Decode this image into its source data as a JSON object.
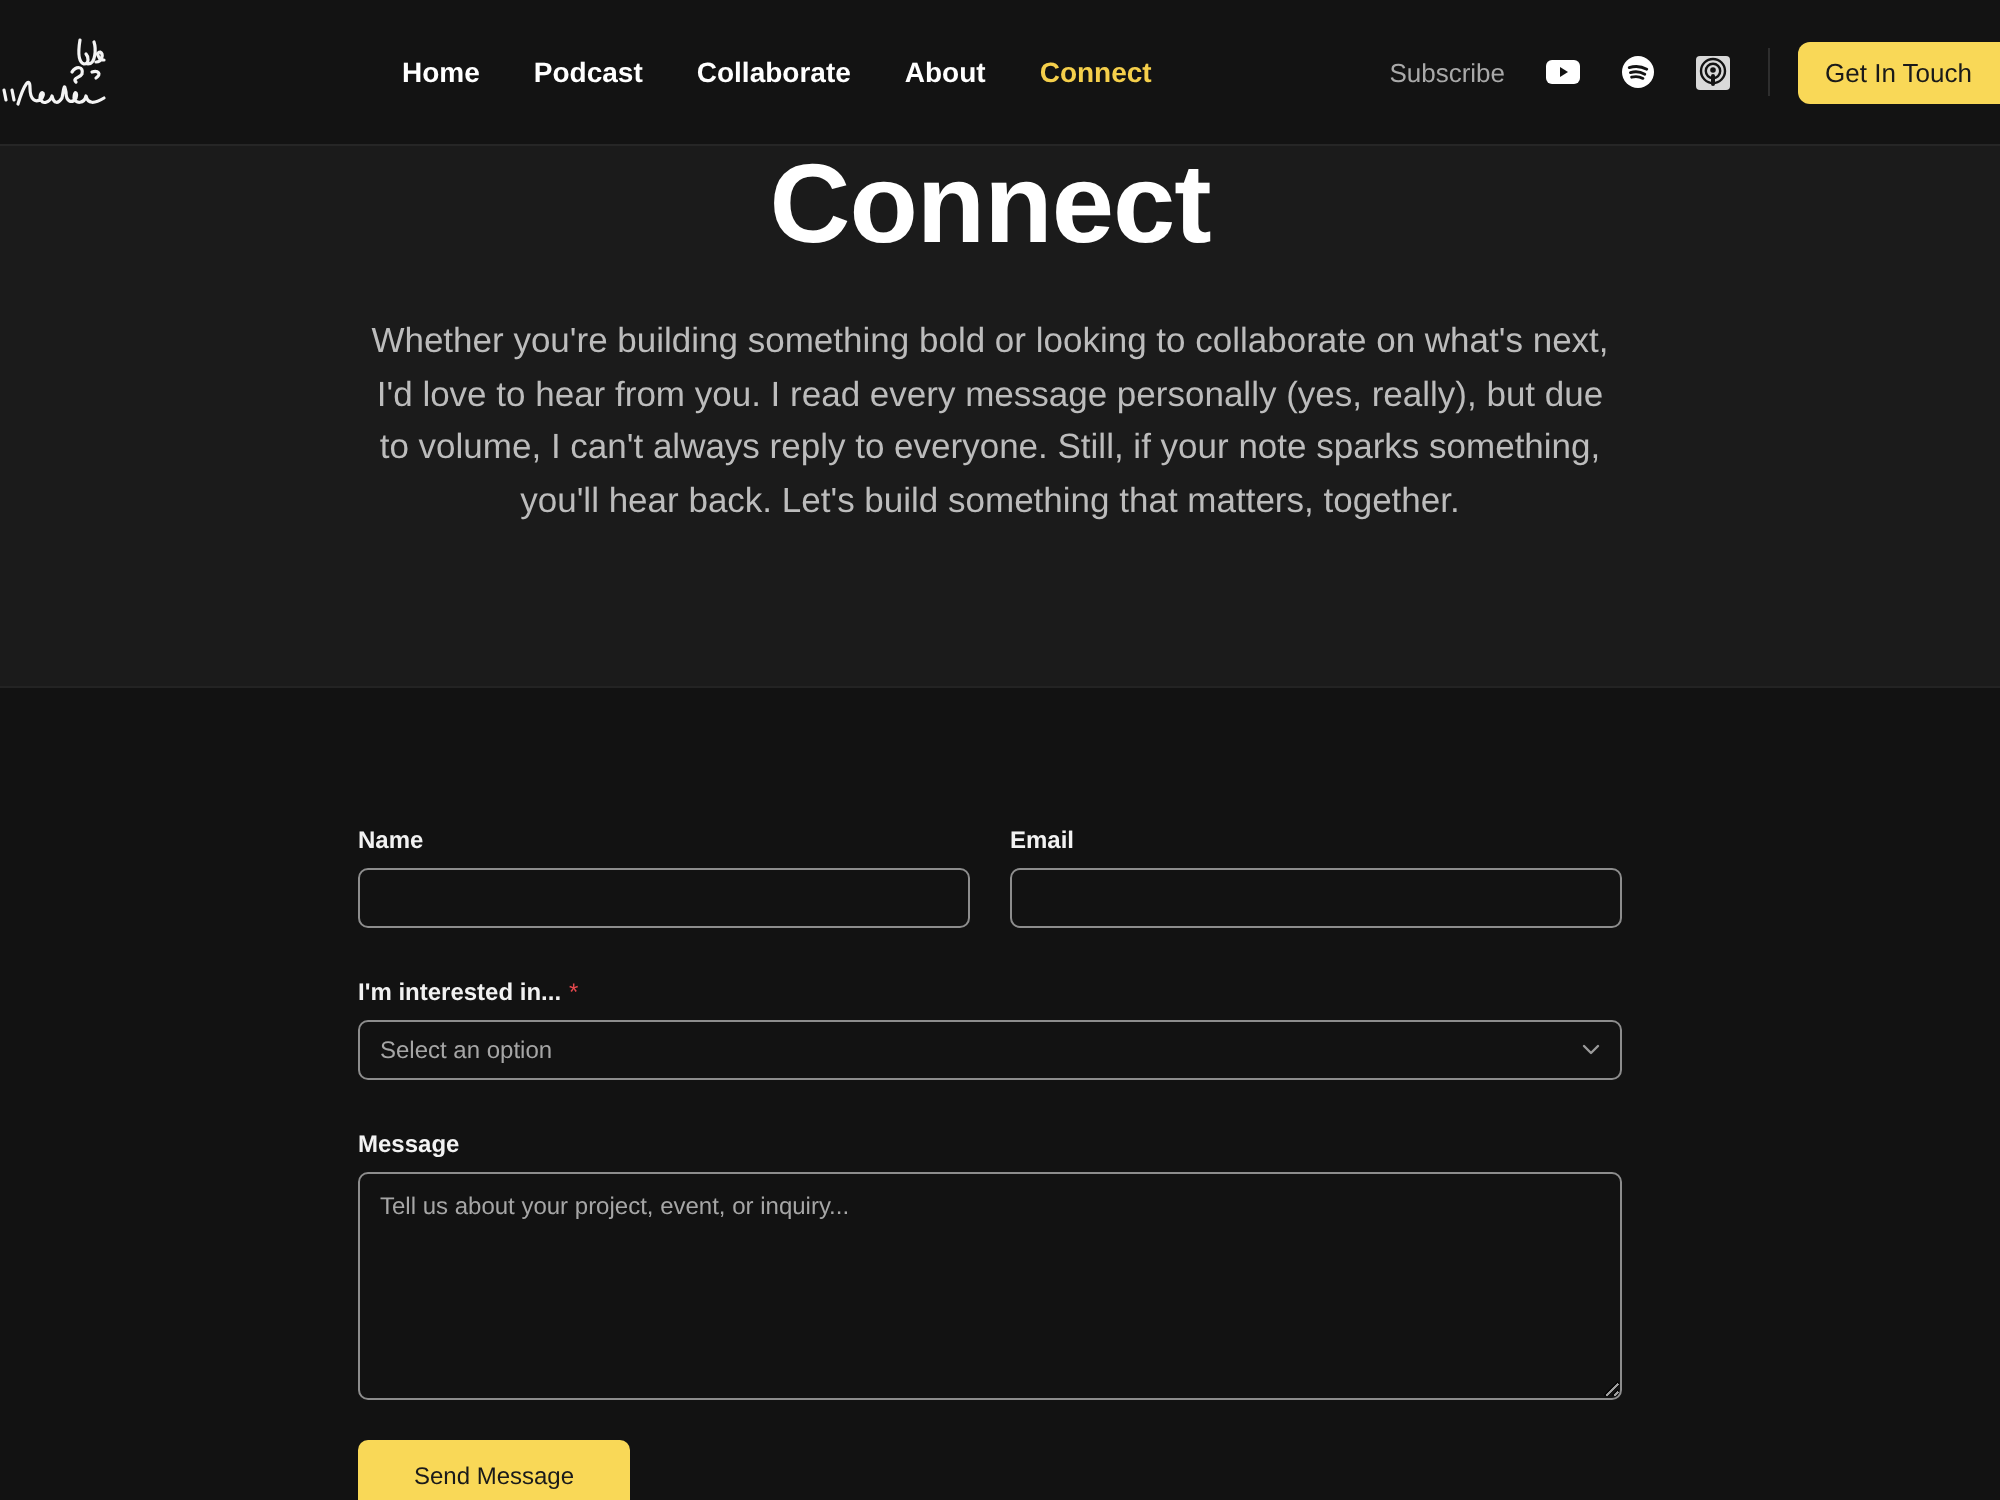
{
  "header": {
    "nav": [
      {
        "label": "Home",
        "selected": false
      },
      {
        "label": "Podcast",
        "selected": false
      },
      {
        "label": "Collaborate",
        "selected": false
      },
      {
        "label": "About",
        "selected": false
      },
      {
        "label": "Connect",
        "selected": true
      }
    ],
    "subscribe_label": "Subscribe",
    "cta": "Get In Touch"
  },
  "hero": {
    "title": "Connect",
    "text": "Whether you're building something bold or looking to collaborate on what's next, I'd love to hear from you. I read every message personally (yes, really), but due to volume, I can't always reply to everyone. Still, if your note sparks something, you'll hear back. Let's build something that matters, together."
  },
  "form": {
    "fields": [
      {
        "kind": "input",
        "label": "Name"
      },
      {
        "kind": "input",
        "label": "Email"
      },
      {
        "kind": "select",
        "label": "I'm interested in...",
        "required_mark": "*",
        "placeholder": "Select an option"
      },
      {
        "kind": "textarea",
        "label": "Message",
        "placeholder": "Tell us about your project, event, or inquiry..."
      }
    ],
    "submit": "Send Message"
  }
}
